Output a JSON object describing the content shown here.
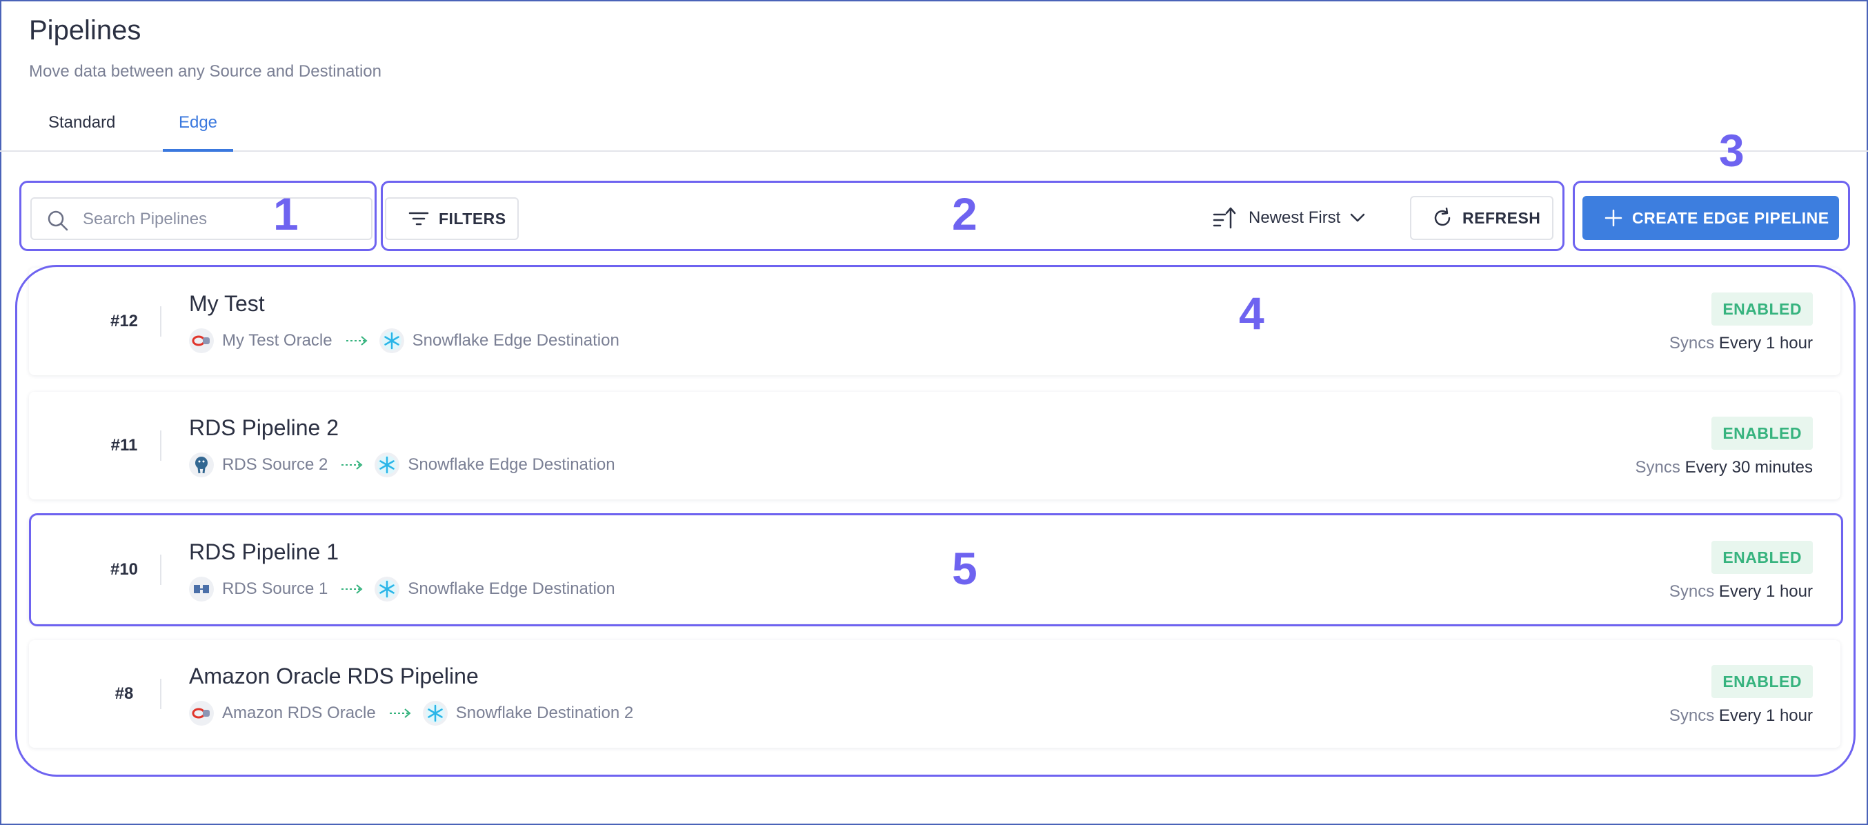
{
  "header": {
    "title": "Pipelines",
    "subtitle": "Move data between any Source and Destination"
  },
  "tabs": [
    {
      "label": "Standard",
      "active": false
    },
    {
      "label": "Edge",
      "active": true
    }
  ],
  "toolbar": {
    "search_placeholder": "Search Pipelines",
    "filters_label": "FILTERS",
    "sort_label": "Newest First",
    "refresh_label": "REFRESH",
    "create_label": "CREATE EDGE PIPELINE"
  },
  "annotations": [
    "1",
    "2",
    "3",
    "4",
    "5"
  ],
  "pipelines": [
    {
      "number": "#12",
      "name": "My Test",
      "source": "My Test Oracle",
      "source_icon": "oracle-icon",
      "destination": "Snowflake Edge Destination",
      "destination_icon": "snowflake-icon",
      "status": "ENABLED",
      "syncs_prefix": "Syncs",
      "syncs_value": "Every 1 hour"
    },
    {
      "number": "#11",
      "name": "RDS Pipeline 2",
      "source": "RDS Source 2",
      "source_icon": "postgres-icon",
      "destination": "Snowflake Edge Destination",
      "destination_icon": "snowflake-icon",
      "status": "ENABLED",
      "syncs_prefix": "Syncs",
      "syncs_value": "Every 30 minutes"
    },
    {
      "number": "#10",
      "name": "RDS Pipeline 1",
      "source": "RDS Source 1",
      "source_icon": "mysql-icon",
      "destination": "Snowflake Edge Destination",
      "destination_icon": "snowflake-icon",
      "status": "ENABLED",
      "syncs_prefix": "Syncs",
      "syncs_value": "Every 1 hour"
    },
    {
      "number": "#8",
      "name": "Amazon Oracle RDS Pipeline",
      "source": "Amazon RDS Oracle",
      "source_icon": "oracle-icon",
      "destination": "Snowflake Destination 2",
      "destination_icon": "snowflake-icon",
      "status": "ENABLED",
      "syncs_prefix": "Syncs",
      "syncs_value": "Every 1 hour"
    }
  ],
  "colors": {
    "accent": "#3d7edf",
    "annotation": "#6e63f0",
    "enabled": "#36b37e",
    "enabled_bg": "#e8f6ee"
  }
}
